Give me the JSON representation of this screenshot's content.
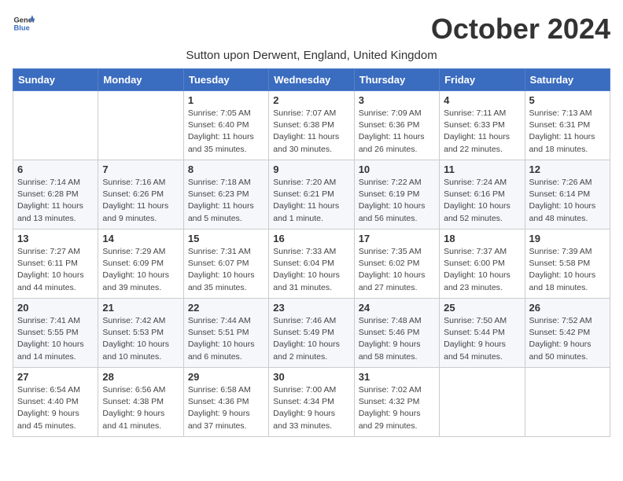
{
  "logo": {
    "text_general": "General",
    "text_blue": "Blue"
  },
  "title": "October 2024",
  "subtitle": "Sutton upon Derwent, England, United Kingdom",
  "weekdays": [
    "Sunday",
    "Monday",
    "Tuesday",
    "Wednesday",
    "Thursday",
    "Friday",
    "Saturday"
  ],
  "weeks": [
    [
      null,
      null,
      {
        "day": 1,
        "sunrise": "7:05 AM",
        "sunset": "6:40 PM",
        "daylight": "11 hours and 35 minutes."
      },
      {
        "day": 2,
        "sunrise": "7:07 AM",
        "sunset": "6:38 PM",
        "daylight": "11 hours and 30 minutes."
      },
      {
        "day": 3,
        "sunrise": "7:09 AM",
        "sunset": "6:36 PM",
        "daylight": "11 hours and 26 minutes."
      },
      {
        "day": 4,
        "sunrise": "7:11 AM",
        "sunset": "6:33 PM",
        "daylight": "11 hours and 22 minutes."
      },
      {
        "day": 5,
        "sunrise": "7:13 AM",
        "sunset": "6:31 PM",
        "daylight": "11 hours and 18 minutes."
      }
    ],
    [
      {
        "day": 6,
        "sunrise": "7:14 AM",
        "sunset": "6:28 PM",
        "daylight": "11 hours and 13 minutes."
      },
      {
        "day": 7,
        "sunrise": "7:16 AM",
        "sunset": "6:26 PM",
        "daylight": "11 hours and 9 minutes."
      },
      {
        "day": 8,
        "sunrise": "7:18 AM",
        "sunset": "6:23 PM",
        "daylight": "11 hours and 5 minutes."
      },
      {
        "day": 9,
        "sunrise": "7:20 AM",
        "sunset": "6:21 PM",
        "daylight": "11 hours and 1 minute."
      },
      {
        "day": 10,
        "sunrise": "7:22 AM",
        "sunset": "6:19 PM",
        "daylight": "10 hours and 56 minutes."
      },
      {
        "day": 11,
        "sunrise": "7:24 AM",
        "sunset": "6:16 PM",
        "daylight": "10 hours and 52 minutes."
      },
      {
        "day": 12,
        "sunrise": "7:26 AM",
        "sunset": "6:14 PM",
        "daylight": "10 hours and 48 minutes."
      }
    ],
    [
      {
        "day": 13,
        "sunrise": "7:27 AM",
        "sunset": "6:11 PM",
        "daylight": "10 hours and 44 minutes."
      },
      {
        "day": 14,
        "sunrise": "7:29 AM",
        "sunset": "6:09 PM",
        "daylight": "10 hours and 39 minutes."
      },
      {
        "day": 15,
        "sunrise": "7:31 AM",
        "sunset": "6:07 PM",
        "daylight": "10 hours and 35 minutes."
      },
      {
        "day": 16,
        "sunrise": "7:33 AM",
        "sunset": "6:04 PM",
        "daylight": "10 hours and 31 minutes."
      },
      {
        "day": 17,
        "sunrise": "7:35 AM",
        "sunset": "6:02 PM",
        "daylight": "10 hours and 27 minutes."
      },
      {
        "day": 18,
        "sunrise": "7:37 AM",
        "sunset": "6:00 PM",
        "daylight": "10 hours and 23 minutes."
      },
      {
        "day": 19,
        "sunrise": "7:39 AM",
        "sunset": "5:58 PM",
        "daylight": "10 hours and 18 minutes."
      }
    ],
    [
      {
        "day": 20,
        "sunrise": "7:41 AM",
        "sunset": "5:55 PM",
        "daylight": "10 hours and 14 minutes."
      },
      {
        "day": 21,
        "sunrise": "7:42 AM",
        "sunset": "5:53 PM",
        "daylight": "10 hours and 10 minutes."
      },
      {
        "day": 22,
        "sunrise": "7:44 AM",
        "sunset": "5:51 PM",
        "daylight": "10 hours and 6 minutes."
      },
      {
        "day": 23,
        "sunrise": "7:46 AM",
        "sunset": "5:49 PM",
        "daylight": "10 hours and 2 minutes."
      },
      {
        "day": 24,
        "sunrise": "7:48 AM",
        "sunset": "5:46 PM",
        "daylight": "9 hours and 58 minutes."
      },
      {
        "day": 25,
        "sunrise": "7:50 AM",
        "sunset": "5:44 PM",
        "daylight": "9 hours and 54 minutes."
      },
      {
        "day": 26,
        "sunrise": "7:52 AM",
        "sunset": "5:42 PM",
        "daylight": "9 hours and 50 minutes."
      }
    ],
    [
      {
        "day": 27,
        "sunrise": "6:54 AM",
        "sunset": "4:40 PM",
        "daylight": "9 hours and 45 minutes."
      },
      {
        "day": 28,
        "sunrise": "6:56 AM",
        "sunset": "4:38 PM",
        "daylight": "9 hours and 41 minutes."
      },
      {
        "day": 29,
        "sunrise": "6:58 AM",
        "sunset": "4:36 PM",
        "daylight": "9 hours and 37 minutes."
      },
      {
        "day": 30,
        "sunrise": "7:00 AM",
        "sunset": "4:34 PM",
        "daylight": "9 hours and 33 minutes."
      },
      {
        "day": 31,
        "sunrise": "7:02 AM",
        "sunset": "4:32 PM",
        "daylight": "9 hours and 29 minutes."
      },
      null,
      null
    ]
  ],
  "daylight_label": "Daylight:",
  "sunrise_label": "Sunrise:",
  "sunset_label": "Sunset:"
}
